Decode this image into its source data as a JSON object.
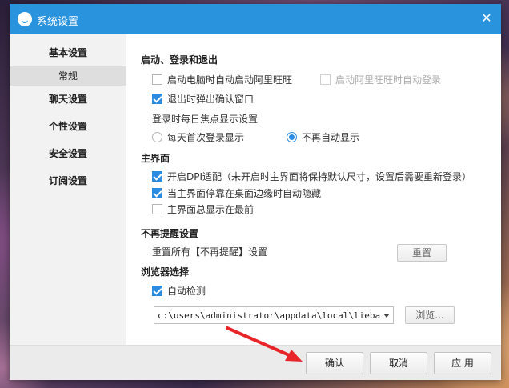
{
  "window": {
    "title": "系统设置"
  },
  "sidebar": {
    "items": [
      {
        "label": "基本设置"
      },
      {
        "label": "常规"
      },
      {
        "label": "聊天设置"
      },
      {
        "label": "个性设置"
      },
      {
        "label": "安全设置"
      },
      {
        "label": "订阅设置"
      }
    ]
  },
  "startup": {
    "title": "启动、登录和退出",
    "auto_start": {
      "label": "启动电脑时自动启动阿里旺旺",
      "checked": false
    },
    "auto_login": {
      "label": "启动阿里旺旺时自动登录",
      "checked": false,
      "disabled": true
    },
    "exit_confirm": {
      "label": "退出时弹出确认窗口",
      "checked": true
    },
    "focus_label": "登录时每日焦点显示设置",
    "focus_first": {
      "label": "每天首次登录显示",
      "checked": false
    },
    "focus_never": {
      "label": "不再自动显示",
      "checked": true
    }
  },
  "main_ui": {
    "title": "主界面",
    "dpi": {
      "label": "开启DPI适配（未开启时主界面将保持默认尺寸，设置后需要重新登录）",
      "checked": true
    },
    "auto_hide": {
      "label": "当主界面停靠在桌面边缘时自动隐藏",
      "checked": true
    },
    "always_top": {
      "label": "主界面总显示在最前",
      "checked": false
    }
  },
  "reminder": {
    "title": "不再提醒设置",
    "reset_label": "重置所有【不再提醒】设置",
    "reset_button": "重置"
  },
  "browser": {
    "title": "浏览器选择",
    "auto_detect": {
      "label": "自动检测",
      "checked": true
    },
    "path_value": "c:\\users\\administrator\\appdata\\local\\liebao\\li",
    "browse_button": "浏览..."
  },
  "footer": {
    "confirm": "确认",
    "cancel": "取消",
    "apply": "应 用"
  },
  "colors": {
    "titlebar": "#2a93dd",
    "checkbox_accent": "#2a8be0",
    "annotation_arrow": "#e8262a"
  }
}
